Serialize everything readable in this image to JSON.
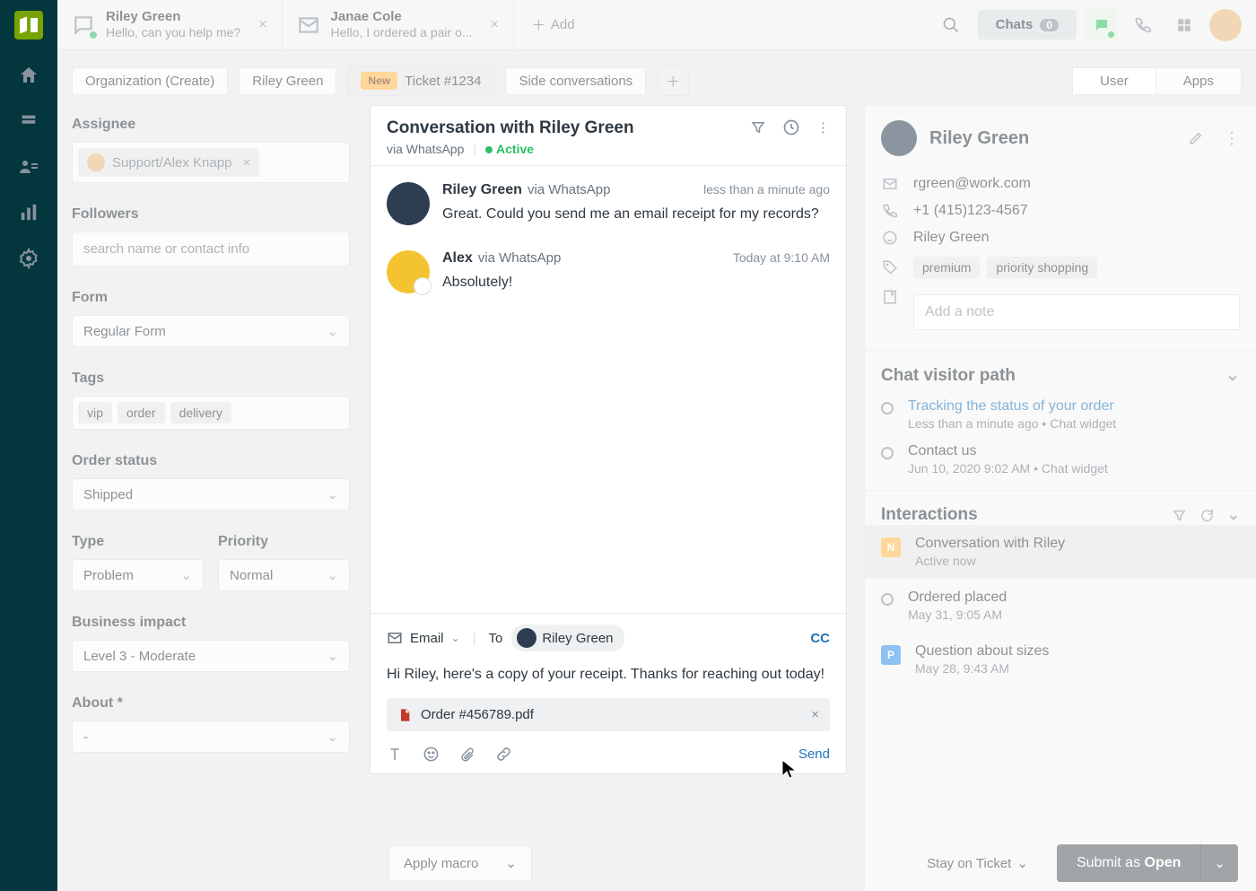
{
  "tabs": [
    {
      "title": "Riley Green",
      "sub": "Hello, can you help me?"
    },
    {
      "title": "Janae Cole",
      "sub": "Hello, I ordered a pair o..."
    }
  ],
  "add_tab": "Add",
  "chats": {
    "label": "Chats",
    "count": "0"
  },
  "breadcrumbs": {
    "org": "Organization (Create)",
    "requester": "Riley Green",
    "new_label": "New",
    "ticket": "Ticket #1234",
    "side": "Side conversations",
    "user": "User",
    "apps": "Apps"
  },
  "props": {
    "assignee_label": "Assignee",
    "assignee_value": "Support/Alex Knapp",
    "followers_label": "Followers",
    "followers_placeholder": "search name or contact info",
    "form_label": "Form",
    "form_value": "Regular Form",
    "tags_label": "Tags",
    "tags": [
      "vip",
      "order",
      "delivery"
    ],
    "order_status_label": "Order status",
    "order_status_value": "Shipped",
    "type_label": "Type",
    "type_value": "Problem",
    "priority_label": "Priority",
    "priority_value": "Normal",
    "impact_label": "Business impact",
    "impact_value": "Level 3 - Moderate",
    "about_label": "About *",
    "about_value": "-"
  },
  "conversation": {
    "title": "Conversation with Riley Green",
    "via": "via WhatsApp",
    "status": "Active",
    "messages": [
      {
        "name": "Riley Green",
        "via": "via WhatsApp",
        "time": "less than a minute ago",
        "text": "Great. Could you send me an email receipt for my records?"
      },
      {
        "name": "Alex",
        "via": "via WhatsApp",
        "time": "Today at 9:10 AM",
        "text": "Absolutely!"
      }
    ]
  },
  "composer": {
    "channel": "Email",
    "to_label": "To",
    "to_value": "Riley Green",
    "cc": "CC",
    "body": "Hi Riley, here's a copy of your receipt. Thanks for reaching out today!",
    "attachment": "Order #456789.pdf",
    "send": "Send"
  },
  "requester": {
    "name": "Riley Green",
    "email": "rgreen@work.com",
    "phone": "+1 (415)123-4567",
    "whatsapp": "Riley Green",
    "tags": [
      "premium",
      "priority shopping"
    ],
    "note_placeholder": "Add a note"
  },
  "visitor_path": {
    "heading": "Chat visitor path",
    "items": [
      {
        "title": "Tracking the status of your order",
        "meta": "Less than a minute ago • Chat widget",
        "link": true
      },
      {
        "title": "Contact us",
        "meta": "Jun 10, 2020 9:02 AM • Chat widget",
        "link": false
      }
    ]
  },
  "interactions": {
    "heading": "Interactions",
    "items": [
      {
        "badge": "N",
        "title": "Conversation with Riley",
        "meta": "Active now",
        "highlight": true
      },
      {
        "circle": true,
        "title": "Ordered placed",
        "meta": "May 31, 9:05 AM"
      },
      {
        "badge": "P",
        "title": "Question about sizes",
        "meta": "May 28, 9:43 AM"
      }
    ]
  },
  "footer": {
    "macro": "Apply macro",
    "stay": "Stay on Ticket",
    "submit_prefix": "Submit as ",
    "submit_status": "Open"
  }
}
